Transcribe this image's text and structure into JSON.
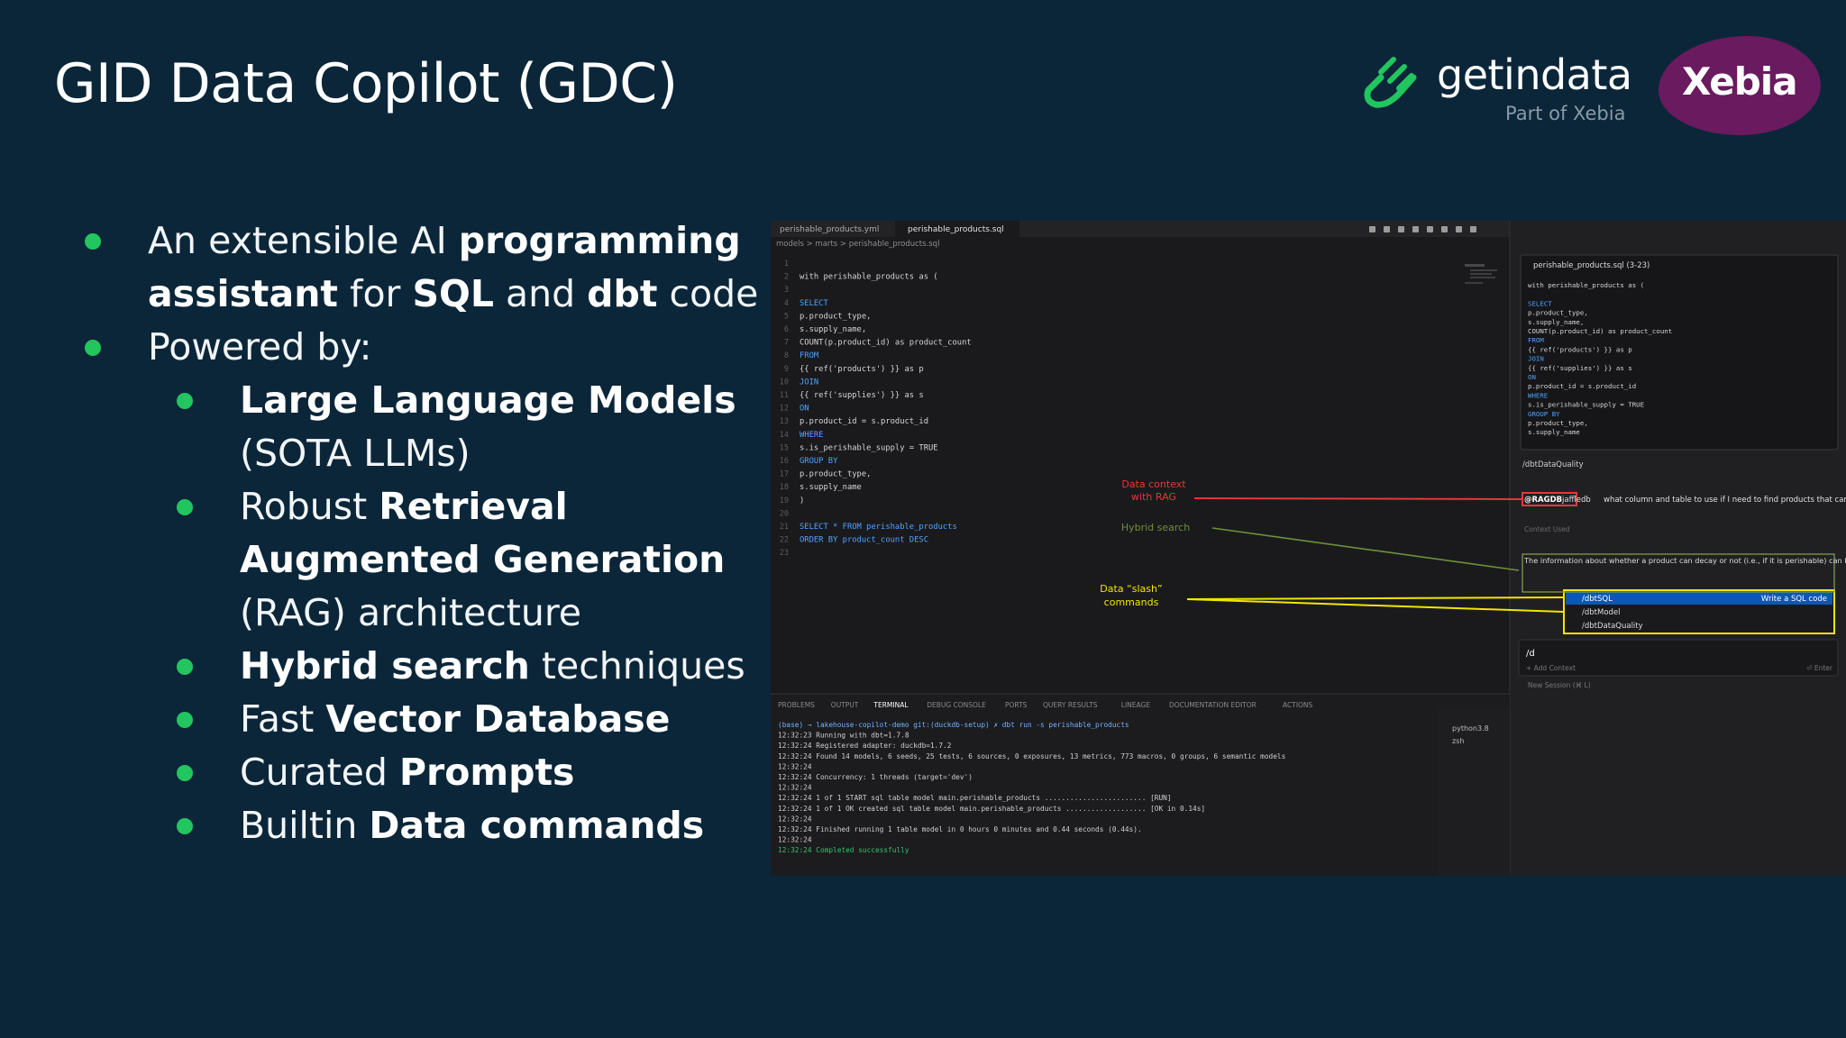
{
  "slide": {
    "title": "GID Data Copilot (GDC)"
  },
  "logo": {
    "brand": "getindata",
    "tagline": "Part of Xebia",
    "partner": "Xebia"
  },
  "bullets": [
    {
      "level": 1,
      "parts": [
        {
          "t": "An extensible AI "
        },
        {
          "t": "programming assistant",
          "b": true
        },
        {
          "t": " for "
        },
        {
          "t": "SQL",
          "b": true
        },
        {
          "t": " and "
        },
        {
          "t": "dbt",
          "b": true
        },
        {
          "t": " code"
        }
      ]
    },
    {
      "level": 1,
      "parts": [
        {
          "t": "Powered by:"
        }
      ]
    },
    {
      "level": 2,
      "parts": [
        {
          "t": "Large Language Models",
          "b": true
        },
        {
          "t": " (SOTA LLMs)"
        }
      ]
    },
    {
      "level": 2,
      "parts": [
        {
          "t": "Robust "
        },
        {
          "t": "Retrieval Augmented Generation",
          "b": true
        },
        {
          "t": " (RAG) architecture"
        }
      ]
    },
    {
      "level": 2,
      "parts": [
        {
          "t": "Hybrid search",
          "b": true
        },
        {
          "t": " techniques"
        }
      ]
    },
    {
      "level": 2,
      "parts": [
        {
          "t": "Fast "
        },
        {
          "t": "Vector Database",
          "b": true
        }
      ]
    },
    {
      "level": 2,
      "parts": [
        {
          "t": "Curated "
        },
        {
          "t": "Prompts",
          "b": true
        }
      ]
    },
    {
      "level": 2,
      "parts": [
        {
          "t": "Builtin "
        },
        {
          "t": "Data commands",
          "b": true
        }
      ]
    }
  ],
  "ide": {
    "tabs": [
      "perishable_products.yml",
      "perishable_products.sql"
    ],
    "breadcrumb": "models > marts > perishable_products.sql",
    "code_lines": [
      "",
      "with perishable_products as (",
      "",
      "    SELECT",
      "        p.product_type,",
      "        s.supply_name,",
      "        COUNT(p.product_id) as product_count",
      "    FROM",
      "        {{ ref('products') }} as p",
      "    JOIN",
      "        {{ ref('supplies') }} as s",
      "    ON",
      "        p.product_id = s.product_id",
      "    WHERE",
      "        s.is_perishable_supply = TRUE",
      "    GROUP BY",
      "        p.product_type,",
      "        s.supply_name",
      ")",
      "",
      "SELECT * FROM perishable_products",
      "ORDER BY product_count DESC",
      ""
    ],
    "panel_tabs": [
      "PROBLEMS",
      "OUTPUT",
      "TERMINAL",
      "DEBUG CONSOLE",
      "PORTS",
      "QUERY RESULTS",
      "LINEAGE",
      "DOCUMENTATION EDITOR",
      "ACTIONS"
    ],
    "terminal_lines": [
      "(base) → lakehouse-copilot-demo git:(duckdb-setup) ✗ dbt run -s perishable_products",
      "12:32:23  Running with dbt=1.7.8",
      "12:32:24  Registered adapter: duckdb=1.7.2",
      "12:32:24  Found 14 models, 6 seeds, 25 tests, 6 sources, 0 exposures, 13 metrics, 773 macros, 0 groups, 6 semantic models",
      "12:32:24",
      "12:32:24  Concurrency: 1 threads (target='dev')",
      "12:32:24",
      "12:32:24  1 of 1 START sql table model main.perishable_products ........................ [RUN]",
      "12:32:24  1 of 1 OK created sql table model main.perishable_products ................... [OK in 0.14s]",
      "12:32:24",
      "12:32:24  Finished running 1 table model in 0 hours 0 minutes and 0.44 seconds (0.44s).",
      "12:32:24",
      "12:32:24  Completed successfully"
    ],
    "terminal_sessions": [
      "python3.8",
      "zsh"
    ],
    "chat": {
      "file_ref": "perishable_products.sql (3-23)",
      "snippet_lines": [
        "with perishable_products as (",
        "",
        "    SELECT",
        "        p.product_type,",
        "        s.supply_name,",
        "        COUNT(p.product_id) as product_count",
        "    FROM",
        "        {{ ref('products') }} as p",
        "    JOIN",
        "        {{ ref('supplies') }} as s",
        "    ON",
        "        p.product_id = s.product_id",
        "    WHERE",
        "        s.is_perishable_supply = TRUE",
        "    GROUP BY",
        "        p.product_type,",
        "        s.supply_name"
      ],
      "command_used": "/dbtDataQuality",
      "rag_tag": "@RAGDB",
      "user_name": "jaffledb",
      "question": "what column and table to use if I need to find products that can decay?",
      "context_label": "Context Used",
      "answer": "The information about whether a product can decay or not (i.e., if it is perishable) can be found in the 'supplies' table under the 'is_perishable_supply' column. The",
      "commands": [
        {
          "name": "/dbtSQL",
          "desc": "Write a SQL code"
        },
        {
          "name": "/dbtModel",
          "desc": ""
        },
        {
          "name": "/dbtDataQuality",
          "desc": ""
        }
      ],
      "input_value": "/d",
      "add_context": "+ Add Context",
      "enter_hint": "⏎ Enter",
      "new_session": "New Session (⌘ L)"
    },
    "annotations": {
      "rag": "Data context\nwith RAG",
      "hybrid": "Hybrid search",
      "slash": "Data “slash”\ncommands"
    },
    "colors": {
      "rag": "#e53935",
      "hybrid": "#6f8f3a",
      "slash": "#f2e600",
      "accent_green": "#22c55e",
      "xebia": "#6a1a5e"
    }
  }
}
